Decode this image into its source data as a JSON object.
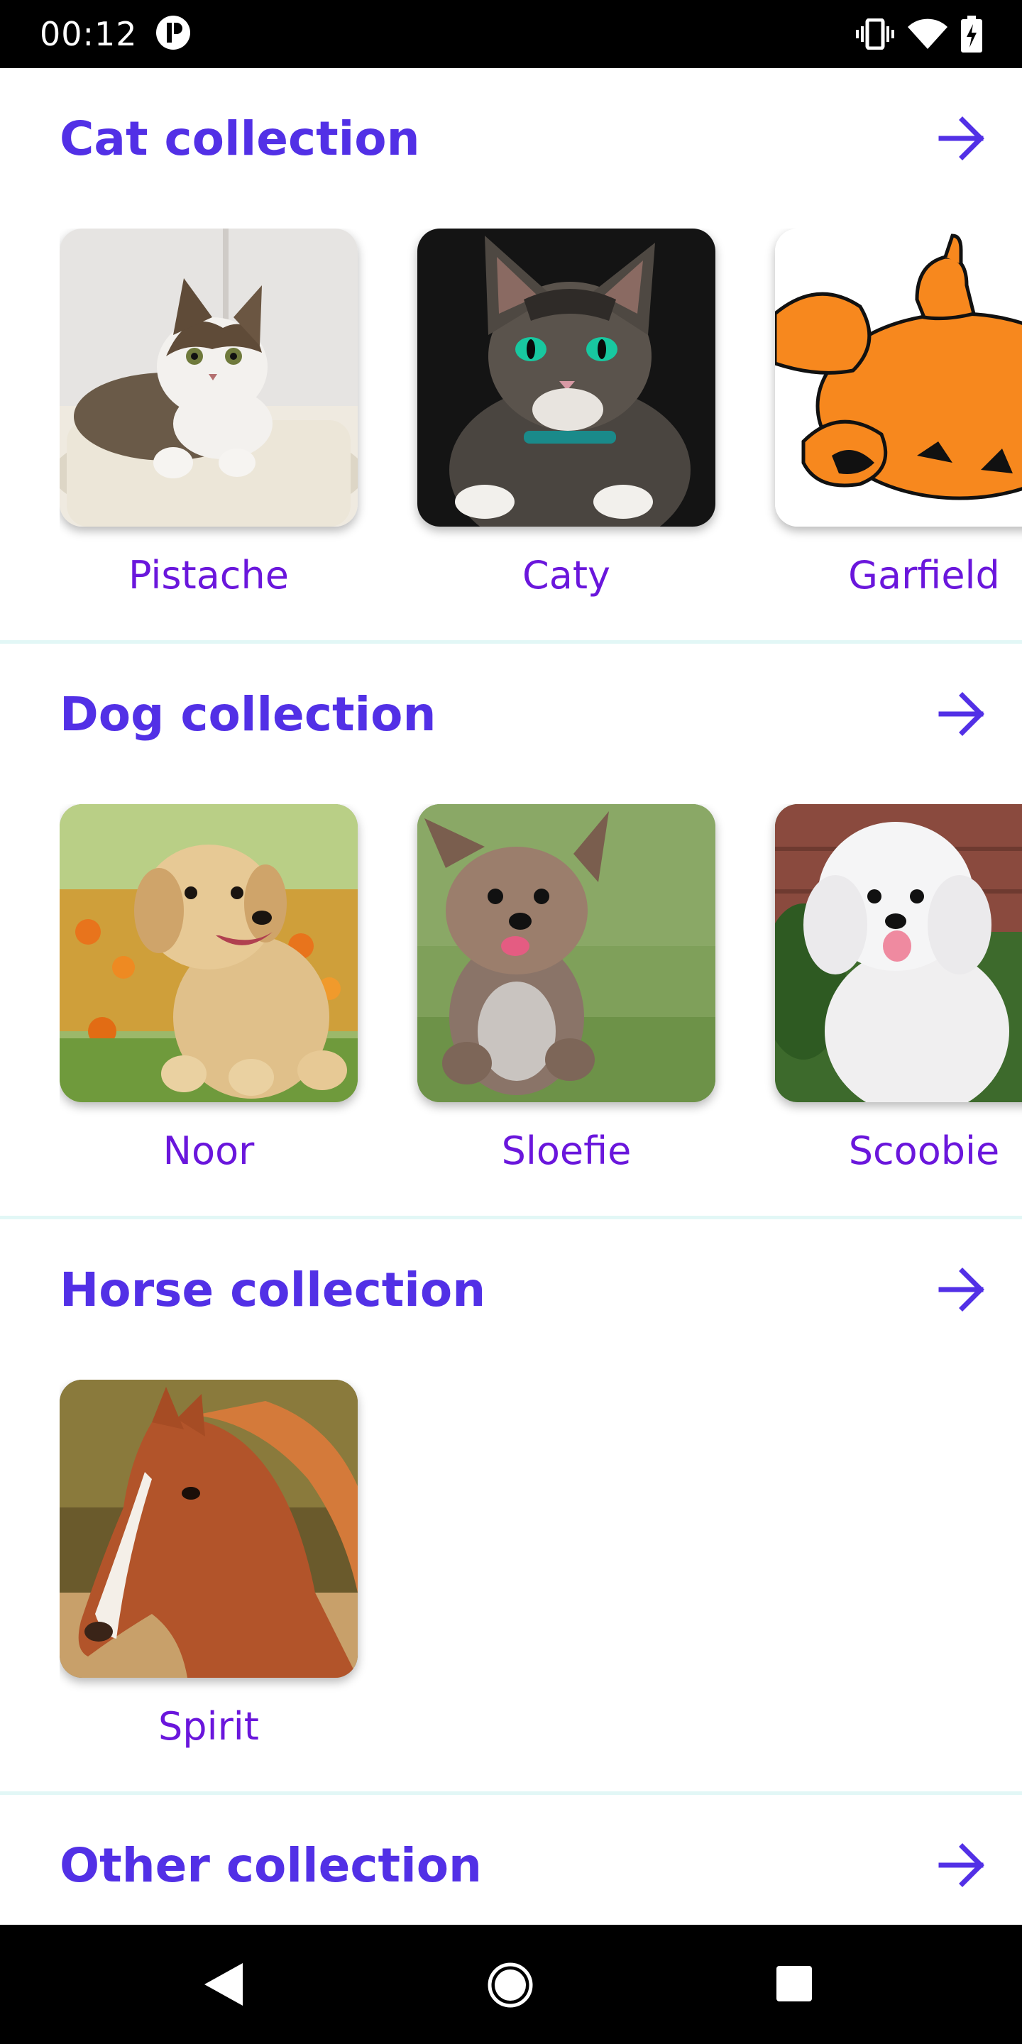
{
  "status_bar": {
    "time": "00:12",
    "icons": [
      "notification-app-icon",
      "vibrate-icon",
      "wifi-icon",
      "battery-icon"
    ]
  },
  "colors": {
    "accent": "#5230e6",
    "item_label": "#6a16dc",
    "divider": "#e2f7f6"
  },
  "sections": [
    {
      "title": "Cat collection",
      "action_icon": "arrow-right-icon",
      "items": [
        {
          "name": "Pistache",
          "image": "tabby-white-cat-photo"
        },
        {
          "name": "Caty",
          "image": "tabby-cat-green-eyes-photo"
        },
        {
          "name": "Garfield",
          "image": "garfield-cartoon-image"
        }
      ]
    },
    {
      "title": "Dog collection",
      "action_icon": "arrow-right-icon",
      "items": [
        {
          "name": "Noor",
          "image": "golden-retriever-puppy-photo"
        },
        {
          "name": "Sloefie",
          "image": "yorkie-running-photo"
        },
        {
          "name": "Scoobie",
          "image": "white-poodle-photo"
        }
      ]
    },
    {
      "title": "Horse collection",
      "action_icon": "arrow-right-icon",
      "items": [
        {
          "name": "Spirit",
          "image": "chestnut-horse-photo"
        }
      ]
    },
    {
      "title": "Other collection",
      "action_icon": "arrow-right-icon",
      "items": []
    }
  ],
  "nav_bar": {
    "buttons": [
      "back-icon",
      "home-icon",
      "recents-icon"
    ]
  }
}
